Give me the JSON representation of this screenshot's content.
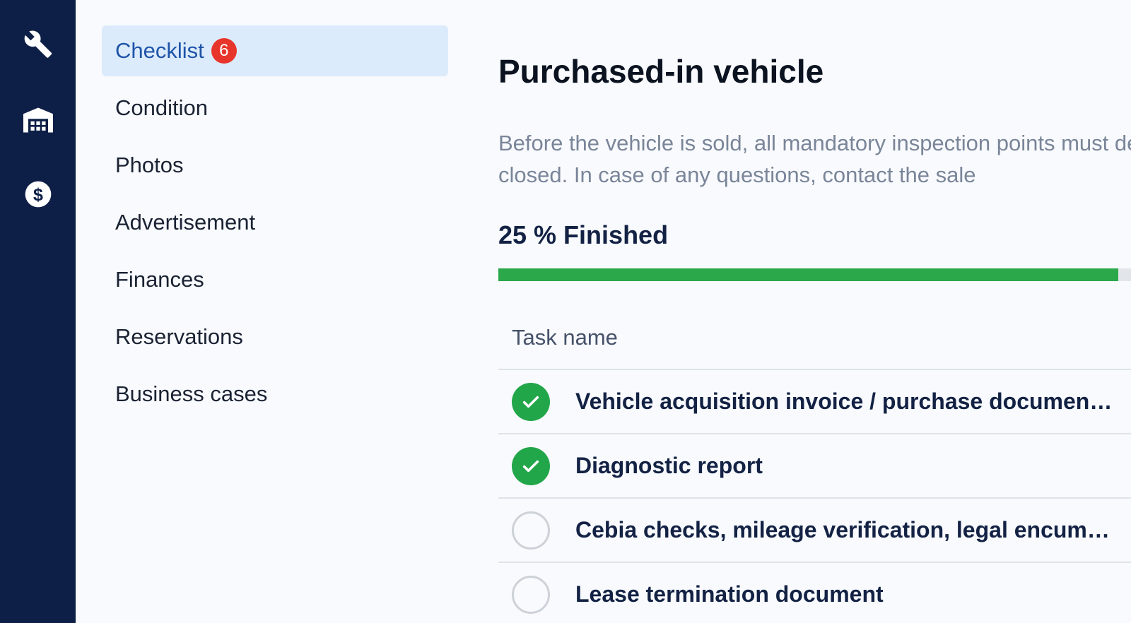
{
  "rail": {
    "items": [
      {
        "icon": "wrench-icon"
      },
      {
        "icon": "garage-icon"
      },
      {
        "icon": "dollar-icon"
      }
    ]
  },
  "subnav": {
    "items": [
      {
        "label": "Checklist",
        "badge": "6",
        "active": true
      },
      {
        "label": "Condition"
      },
      {
        "label": "Photos"
      },
      {
        "label": "Advertisement"
      },
      {
        "label": "Finances"
      },
      {
        "label": "Reservations"
      },
      {
        "label": "Business cases"
      }
    ]
  },
  "main": {
    "title": "Purchased-in vehicle",
    "description": "Before the vehicle is sold, all mandatory inspection points must deal cannot be closed. In case of any questions, contact the sale",
    "progress_label": "25 % Finished",
    "progress_value": 0.98,
    "colors": {
      "progress": "#2aa84a",
      "required": "#e23a31",
      "active_nav": "#dcebfb"
    }
  },
  "tasks": {
    "header": "Task name",
    "rows": [
      {
        "name": "Vehicle acquisition invoice / purchase document",
        "required": "*",
        "done": true
      },
      {
        "name": "Diagnostic report",
        "done": true
      },
      {
        "name": "Cebia checks, mileage verification, legal encumbran…",
        "done": false
      },
      {
        "name": "Lease termination document",
        "done": false
      }
    ]
  }
}
